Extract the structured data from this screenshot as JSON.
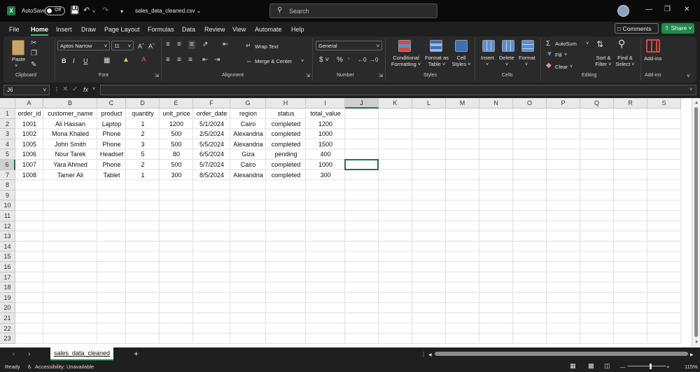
{
  "titlebar": {
    "autosave_label": "AutoSave",
    "autosave_state": "Off",
    "filename": "sales_data_cleaned.csv ⌄",
    "search_placeholder": "Search",
    "icons": [
      "excel-logo",
      "save-icon",
      "undo-icon",
      "redo-icon",
      "customize-icon",
      "search-icon",
      "avatar",
      "minimize-icon",
      "restore-icon",
      "close-icon"
    ]
  },
  "menu": {
    "tabs": [
      "File",
      "Home",
      "Insert",
      "Draw",
      "Page Layout",
      "Formulas",
      "Data",
      "Review",
      "View",
      "Automate",
      "Help"
    ],
    "active": "Home",
    "comments_label": "Comments",
    "share_label": "Share"
  },
  "ribbon": {
    "clipboard": {
      "paste": "Paste",
      "label": "Clipboard"
    },
    "font": {
      "name": "Aptos Narrow",
      "size": "11",
      "label": "Font"
    },
    "alignment": {
      "wrap": "Wrap Text",
      "merge": "Merge & Center",
      "label": "Alignment"
    },
    "number": {
      "format": "General",
      "label": "Number"
    },
    "styles": {
      "conditional": [
        "Conditional",
        "Formatting"
      ],
      "format_table": [
        "Format as",
        "Table"
      ],
      "cell_styles": [
        "Cell",
        "Styles"
      ],
      "label": "Styles"
    },
    "cells": {
      "insert": "Insert",
      "delete": "Delete",
      "format": "Format",
      "label": "Cells"
    },
    "editing": {
      "autosum": "AutoSum",
      "fill": "Fill",
      "clear": "Clear",
      "sort": [
        "Sort &",
        "Filter"
      ],
      "find": [
        "Find &",
        "Select"
      ],
      "label": "Editing"
    },
    "addins": {
      "button": "Add-ins",
      "label": "Add-ins"
    }
  },
  "formula_bar": {
    "name_box": "J6",
    "fx": "fx",
    "value": ""
  },
  "columns": [
    "A",
    "B",
    "C",
    "D",
    "E",
    "F",
    "G",
    "H",
    "I",
    "J",
    "K",
    "L",
    "M",
    "N",
    "O",
    "P",
    "Q",
    "R",
    "S"
  ],
  "rows": [
    "1",
    "2",
    "3",
    "4",
    "5",
    "6",
    "7",
    "8",
    "9",
    "10",
    "11",
    "12",
    "13",
    "14",
    "15",
    "16",
    "17",
    "18",
    "19",
    "20",
    "21",
    "22",
    "23"
  ],
  "selected_cell": {
    "col": "J",
    "row": "6"
  },
  "table": {
    "headers": [
      "order_id",
      "customer_name",
      "product",
      "quantity",
      "unit_price",
      "order_date",
      "region",
      "status",
      "total_value"
    ],
    "rows": [
      [
        "1001",
        "Ali Hassan",
        "Laptop",
        "1",
        "1200",
        "5/1/2024",
        "Cairo",
        "completed",
        "1200"
      ],
      [
        "1002",
        "Mona Khaled",
        "Phone",
        "2",
        "500",
        "2/5/2024",
        "Alexandria",
        "completed",
        "1000"
      ],
      [
        "1005",
        "John Smith",
        "Phone",
        "3",
        "500",
        "5/5/2024",
        "Alexandria",
        "completed",
        "1500"
      ],
      [
        "1006",
        "Nour Tarek",
        "Headset",
        "5",
        "80",
        "6/5/2024",
        "Giza",
        "pending",
        "400"
      ],
      [
        "1007",
        "Yara Ahmed",
        "Phone",
        "2",
        "500",
        "5/7/2024",
        "Cairo",
        "completed",
        "1000"
      ],
      [
        "1008",
        "Tamer Ali",
        "Tablet",
        "1",
        "300",
        "8/5/2024",
        "Alexandria",
        "completed",
        "300"
      ]
    ]
  },
  "sheets": {
    "active": "sales_data_cleaned",
    "add": "+"
  },
  "status": {
    "ready": "Ready",
    "accessibility": "Accessibility: Unavailable",
    "zoom": "115%"
  }
}
